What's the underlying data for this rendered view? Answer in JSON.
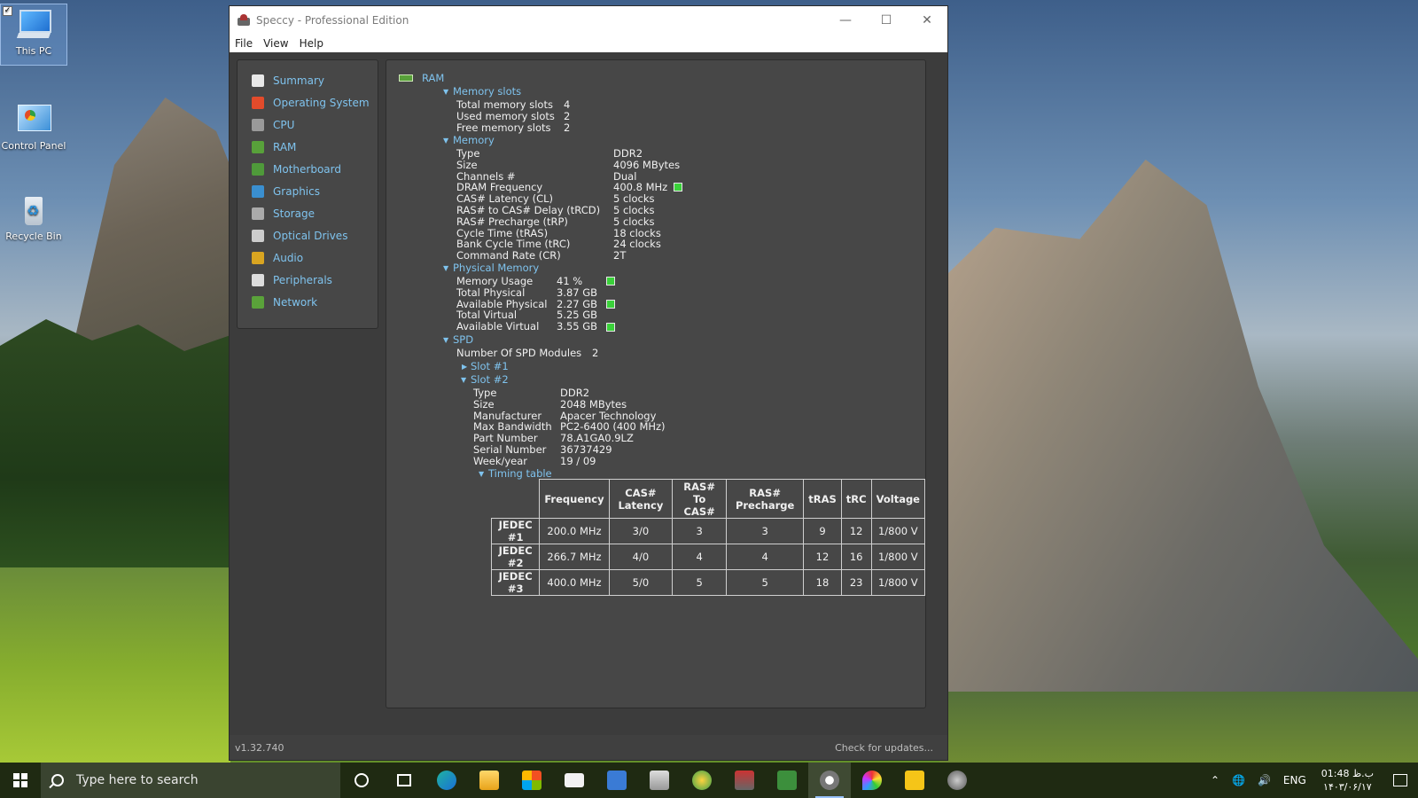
{
  "desktop": {
    "icons": [
      {
        "label": "This PC"
      },
      {
        "label": "Control Panel"
      },
      {
        "label": "Recycle Bin"
      }
    ]
  },
  "window": {
    "title": "Speccy - Professional Edition",
    "menu": [
      "File",
      "View",
      "Help"
    ],
    "version": "v1.32.740",
    "update_link": "Check for updates..."
  },
  "sidebar": {
    "items": [
      {
        "label": "Summary",
        "icon": "summary-icon",
        "color": "#e8e8e8"
      },
      {
        "label": "Operating System",
        "icon": "windows-icon",
        "color": "#e24b2b"
      },
      {
        "label": "CPU",
        "icon": "cpu-icon",
        "color": "#9a9a9a"
      },
      {
        "label": "RAM",
        "icon": "ram-icon",
        "color": "#58a13a"
      },
      {
        "label": "Motherboard",
        "icon": "motherboard-icon",
        "color": "#4f9a3a"
      },
      {
        "label": "Graphics",
        "icon": "monitor-icon",
        "color": "#3a8fd0"
      },
      {
        "label": "Storage",
        "icon": "hdd-icon",
        "color": "#aaaaaa"
      },
      {
        "label": "Optical Drives",
        "icon": "disc-icon",
        "color": "#cccccc"
      },
      {
        "label": "Audio",
        "icon": "speaker-icon",
        "color": "#d9a521"
      },
      {
        "label": "Peripherals",
        "icon": "mouse-icon",
        "color": "#dddddd"
      },
      {
        "label": "Network",
        "icon": "network-icon",
        "color": "#5aa23a"
      }
    ]
  },
  "ram": {
    "heading": "RAM",
    "memory_slots": {
      "label": "Memory slots",
      "rows": [
        {
          "k": "Total memory slots",
          "v": "4"
        },
        {
          "k": "Used memory slots",
          "v": "2"
        },
        {
          "k": "Free memory slots",
          "v": "2"
        }
      ]
    },
    "memory": {
      "label": "Memory",
      "rows": [
        {
          "k": "Type",
          "v": "DDR2"
        },
        {
          "k": "Size",
          "v": "4096 MBytes"
        },
        {
          "k": "Channels #",
          "v": "Dual"
        },
        {
          "k": "DRAM Frequency",
          "v": "400.8 MHz"
        },
        {
          "k": "CAS# Latency (CL)",
          "v": "5 clocks"
        },
        {
          "k": "RAS# to CAS# Delay (tRCD)",
          "v": "5 clocks"
        },
        {
          "k": "RAS# Precharge (tRP)",
          "v": "5 clocks"
        },
        {
          "k": "Cycle Time (tRAS)",
          "v": "18 clocks"
        },
        {
          "k": "Bank Cycle Time (tRC)",
          "v": "24 clocks"
        },
        {
          "k": "Command Rate (CR)",
          "v": "2T"
        }
      ]
    },
    "physical_memory": {
      "label": "Physical Memory",
      "rows": [
        {
          "k": "Memory Usage",
          "v": "41 %"
        },
        {
          "k": "Total Physical",
          "v": "3.87 GB"
        },
        {
          "k": "Available Physical",
          "v": "2.27 GB"
        },
        {
          "k": "Total Virtual",
          "v": "5.25 GB"
        },
        {
          "k": "Available Virtual",
          "v": "3.55 GB"
        }
      ]
    },
    "spd": {
      "label": "SPD",
      "modules_label": "Number Of SPD Modules",
      "modules_value": "2",
      "slot1": "Slot #1",
      "slot2": "Slot #2",
      "slot2_rows": [
        {
          "k": "Type",
          "v": "DDR2"
        },
        {
          "k": "Size",
          "v": "2048 MBytes"
        },
        {
          "k": "Manufacturer",
          "v": "Apacer Technology"
        },
        {
          "k": "Max Bandwidth",
          "v": "PC2-6400 (400 MHz)"
        },
        {
          "k": "Part Number",
          "v": "78.A1GA0.9LZ"
        },
        {
          "k": "Serial Number",
          "v": "36737429"
        },
        {
          "k": "Week/year",
          "v": "19 / 09"
        }
      ],
      "timing_label": "Timing table",
      "timing_headers": [
        "Frequency",
        "CAS# Latency",
        "RAS# To CAS#",
        "RAS# Precharge",
        "tRAS",
        "tRC",
        "Voltage"
      ],
      "timing_rows": [
        {
          "name": "JEDEC #1",
          "cells": [
            "200.0 MHz",
            "3/0",
            "3",
            "3",
            "9",
            "12",
            "1/800 V"
          ]
        },
        {
          "name": "JEDEC #2",
          "cells": [
            "266.7 MHz",
            "4/0",
            "4",
            "4",
            "12",
            "16",
            "1/800 V"
          ]
        },
        {
          "name": "JEDEC #3",
          "cells": [
            "400.0 MHz",
            "5/0",
            "5",
            "5",
            "18",
            "23",
            "1/800 V"
          ]
        }
      ]
    }
  },
  "taskbar": {
    "search_placeholder": "Type here to search",
    "language": "ENG",
    "time": "01:48 ب.ظ",
    "date": "۱۴۰۳/۰۶/۱۷"
  }
}
